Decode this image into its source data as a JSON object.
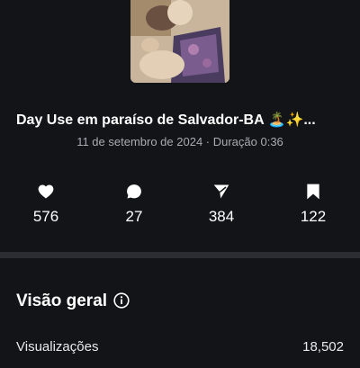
{
  "video": {
    "title": "Day Use em paraíso de Salvador-BA 🏝️✨...",
    "meta": "11 de setembro de 2024 · Duração 0:36"
  },
  "stats": [
    {
      "icon": "heart-icon",
      "value": "576"
    },
    {
      "icon": "comment-icon",
      "value": "27"
    },
    {
      "icon": "share-icon",
      "value": "384"
    },
    {
      "icon": "bookmark-icon",
      "value": "122"
    }
  ],
  "overview": {
    "title": "Visão geral",
    "rows": [
      {
        "label": "Visualizações",
        "value": "18,502"
      }
    ]
  },
  "colors": {
    "background": "#131418",
    "divider": "#2b2d33",
    "muted_text": "#a8abb2"
  }
}
